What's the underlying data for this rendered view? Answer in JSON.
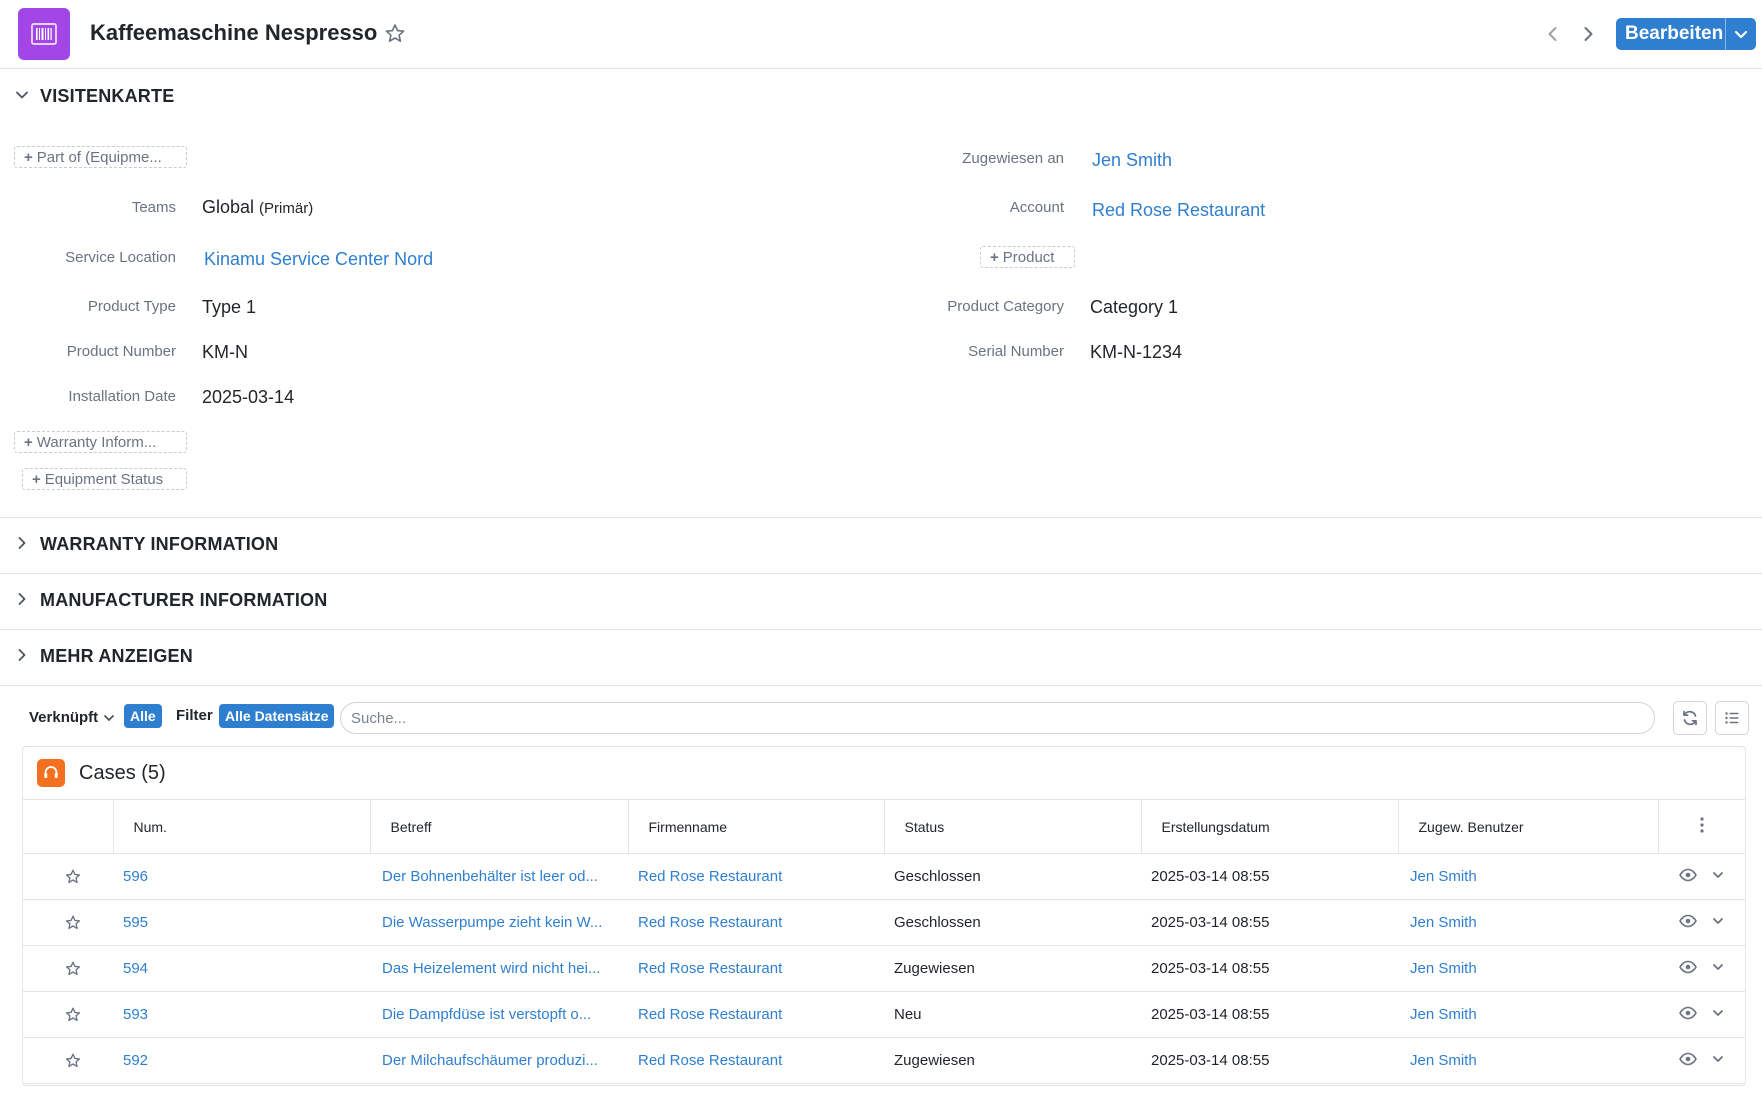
{
  "header": {
    "title": "Kaffeemaschine Nespresso",
    "edit_label": "Bearbeiten"
  },
  "sections": {
    "visitenkarte": "VISITENKARTE",
    "warranty": "WARRANTY INFORMATION",
    "manufacturer": "MANUFACTURER INFORMATION",
    "more": "MEHR ANZEIGEN"
  },
  "fields": {
    "part_of_add": "Part of (Equipme...",
    "teams_label": "Teams",
    "teams_value": "Global",
    "teams_primary": "(Primär)",
    "service_location_label": "Service Location",
    "service_location_value": "Kinamu Service Center Nord",
    "product_type_label": "Product Type",
    "product_type_value": "Type 1",
    "product_number_label": "Product Number",
    "product_number_value": "KM-N",
    "installation_date_label": "Installation Date",
    "installation_date_value": "2025-03-14",
    "warranty_add": "Warranty Inform...",
    "equipment_status_add": "Equipment Status",
    "assigned_label": "Zugewiesen an",
    "assigned_value": "Jen Smith",
    "account_label": "Account",
    "account_value": "Red Rose Restaurant",
    "product_add": "Product",
    "product_category_label": "Product Category",
    "product_category_value": "Category 1",
    "serial_number_label": "Serial Number",
    "serial_number_value": "KM-N-1234"
  },
  "filterbar": {
    "linked_label": "Verknüpft",
    "all_chip": "Alle",
    "filter_label": "Filter",
    "all_records_chip": "Alle Datensätze",
    "search_placeholder": "Suche..."
  },
  "cases": {
    "title": "Cases (5)",
    "columns": [
      "Num.",
      "Betreff",
      "Firmenname",
      "Status",
      "Erstellungsdatum",
      "Zugew. Benutzer"
    ],
    "rows": [
      {
        "num": "596",
        "subject": "Der Bohnenbehälter ist leer od...",
        "company": "Red Rose Restaurant",
        "status": "Geschlossen",
        "created": "2025-03-14 08:55",
        "user": "Jen Smith"
      },
      {
        "num": "595",
        "subject": "Die Wasserpumpe zieht kein W...",
        "company": "Red Rose Restaurant",
        "status": "Geschlossen",
        "created": "2025-03-14 08:55",
        "user": "Jen Smith"
      },
      {
        "num": "594",
        "subject": "Das Heizelement wird nicht hei...",
        "company": "Red Rose Restaurant",
        "status": "Zugewiesen",
        "created": "2025-03-14 08:55",
        "user": "Jen Smith"
      },
      {
        "num": "593",
        "subject": "Die Dampfdüse ist verstopft o...",
        "company": "Red Rose Restaurant",
        "status": "Neu",
        "created": "2025-03-14 08:55",
        "user": "Jen Smith"
      },
      {
        "num": "592",
        "subject": "Der Milchaufschäumer produzi...",
        "company": "Red Rose Restaurant",
        "status": "Zugewiesen",
        "created": "2025-03-14 08:55",
        "user": "Jen Smith"
      }
    ]
  },
  "colors": {
    "accent": "#2f7fd0",
    "app_icon": "#a346e8",
    "cases_icon": "#f37021"
  },
  "icons": {
    "app": "barcode-icon",
    "favorite": "star-icon",
    "prev": "chevron-left-icon",
    "next": "chevron-right-icon",
    "refresh": "refresh-icon",
    "list": "list-icon",
    "cases": "headset-icon",
    "row_view": "eye-icon",
    "row_menu": "chevron-down-icon"
  }
}
